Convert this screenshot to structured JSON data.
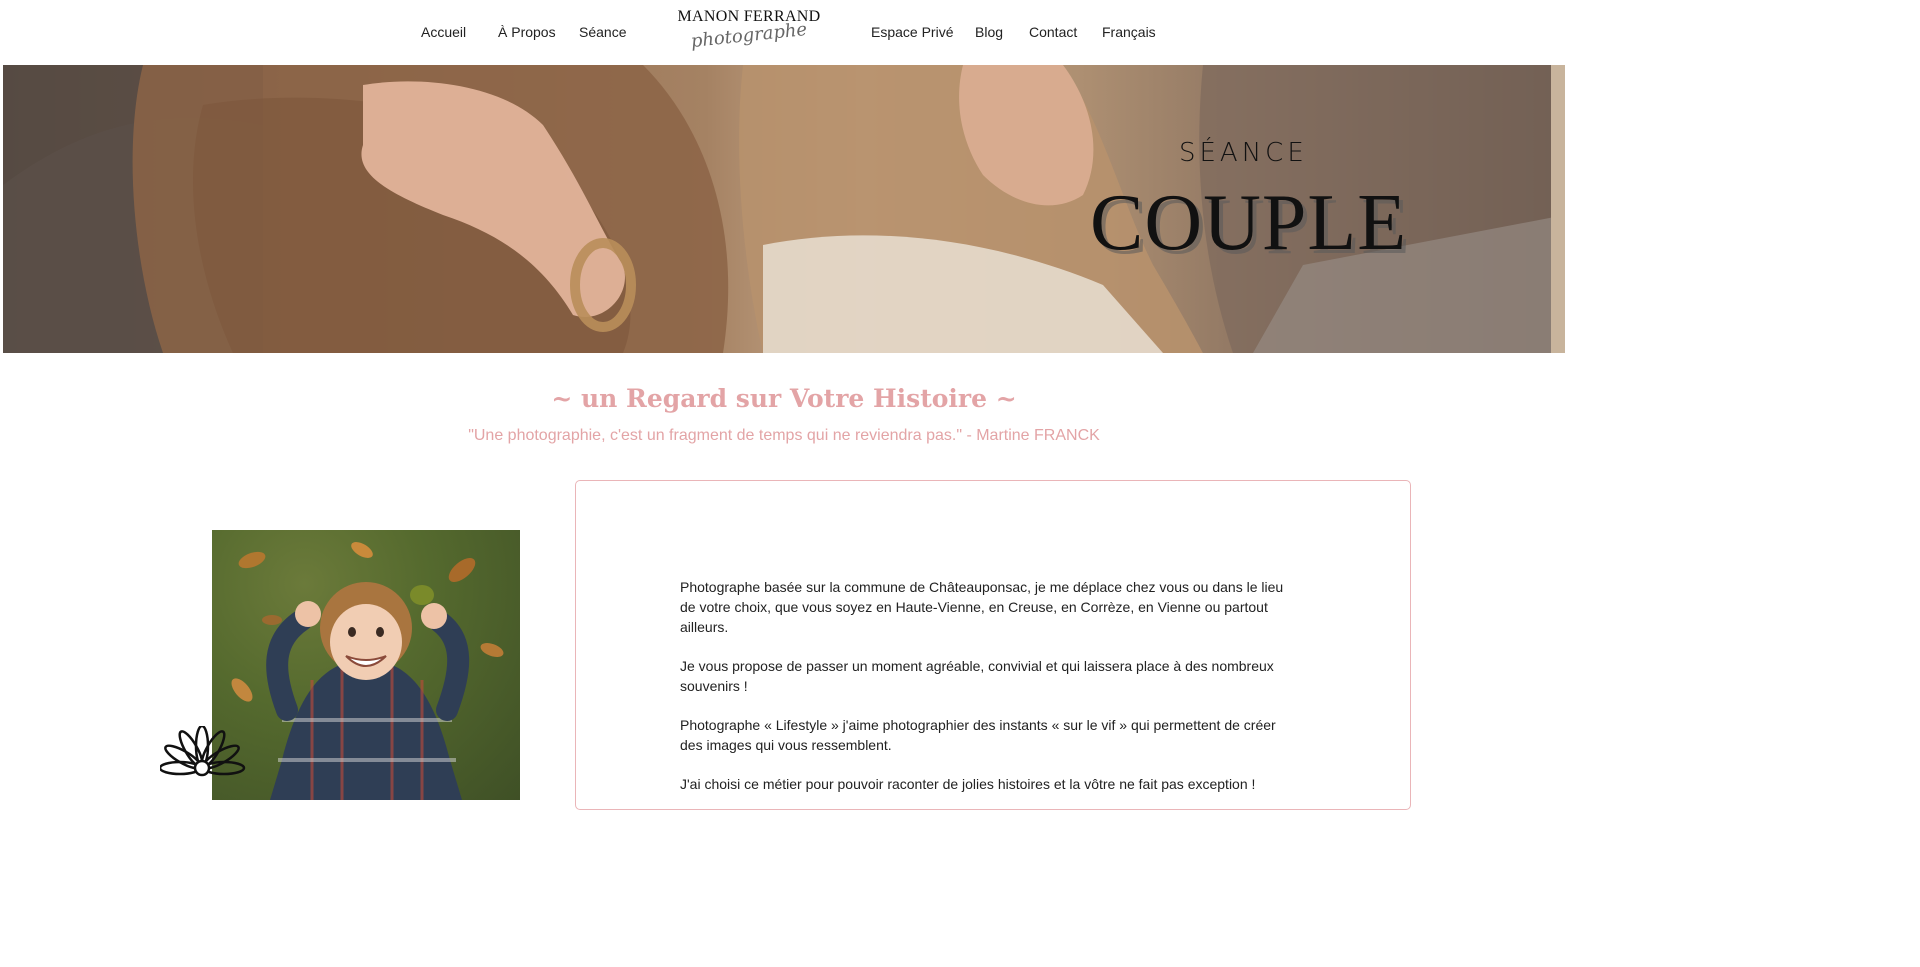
{
  "nav": {
    "left": [
      "Accueil",
      "À Propos",
      "Séance"
    ],
    "right": [
      "Espace Privé",
      "Blog",
      "Contact",
      "Français"
    ]
  },
  "logo": {
    "name": "MANON FERRAND",
    "subtitle": "photographe"
  },
  "hero": {
    "sup": "SÉANCE",
    "title": "COUPLE"
  },
  "intro": {
    "tagline": "~ un Regard sur Votre Histoire ~",
    "quote": "\"Une photographie, c'est un fragment de temps qui ne reviendra pas.\" - Martine FRANCK"
  },
  "about": {
    "paragraphs": [
      "Photographe basée sur la commune de Châteauponsac, je me déplace chez vous ou dans le lieu de votre choix, que vous soyez en Haute-Vienne, en Creuse, en Corrèze, en Vienne ou partout ailleurs.",
      "Je vous propose de passer un moment agréable, convivial et qui laissera place à des nombreux souvenirs !",
      "Photographe « Lifestyle » j'aime photographier des instants « sur le vif » qui permettent de créer des images qui vous ressemblent.",
      "J'ai choisi ce métier pour pouvoir raconter de jolies histoires et la vôtre ne fait pas exception !"
    ]
  },
  "colors": {
    "accent_pink": "#e3a4a6",
    "card_border": "#eab5b8",
    "text": "#222222"
  },
  "icons": {
    "flower": "flower-icon"
  }
}
